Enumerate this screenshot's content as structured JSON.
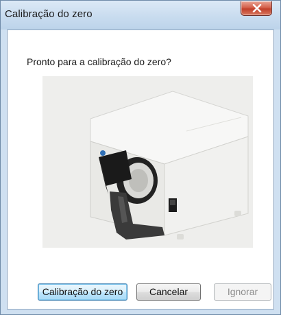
{
  "window": {
    "title": "Calibração do zero"
  },
  "dialog": {
    "prompt": "Pronto para a calibração do zero?",
    "image": "device-photo"
  },
  "buttons": {
    "calibrate_label": "Calibração do zero",
    "cancel_label": "Cancelar",
    "ignore_label": "Ignorar"
  },
  "icons": {
    "close": "close-icon"
  },
  "colors": {
    "close_button": "#c8472f",
    "default_button_border": "#3c7fb1",
    "title_bar": "#c9dcef"
  }
}
